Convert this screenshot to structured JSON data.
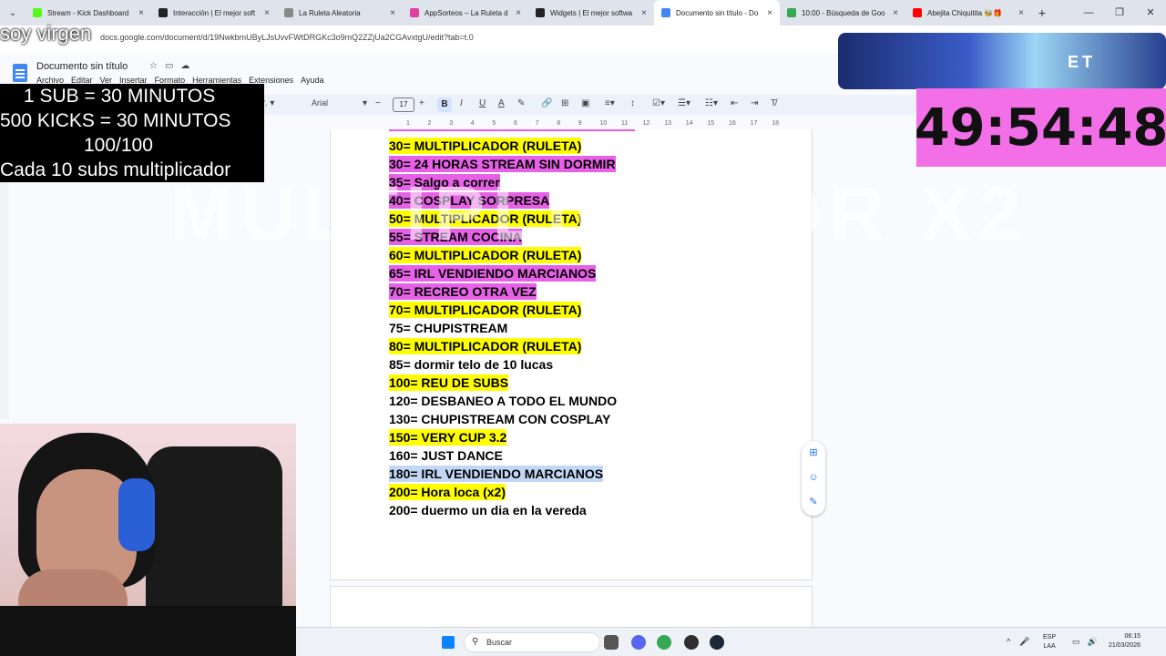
{
  "browser": {
    "tabs": [
      {
        "label": "Stream - Kick Dashboard",
        "color": "#53fc18"
      },
      {
        "label": "Interacción | El mejor soft",
        "color": "#222222"
      },
      {
        "label": "La Ruleta Aleatoria",
        "color": "#888888"
      },
      {
        "label": "AppSorteos – La Ruleta d",
        "color": "#e23fa0"
      },
      {
        "label": "Widgets | El mejor softwa",
        "color": "#222222"
      },
      {
        "label": "Documento sin título - Do",
        "color": "#4285f4",
        "active": true
      },
      {
        "label": "10:00 - Búsqueda de Goo",
        "color": "#34a853"
      },
      {
        "label": "Abejita Chiquitita 🐝🎁",
        "color": "#ff0000"
      }
    ],
    "url": "docs.google.com/document/d/19NwkbmUByLJsUvvFWtDRGKc3o9mQ2ZZjUa2CGAvxtgU/edit?tab=t.0"
  },
  "docs": {
    "title": "Documento sin título",
    "menu": [
      "Archivo",
      "Editar",
      "Ver",
      "Insertar",
      "Formato",
      "Herramientas",
      "Extensiones",
      "Ayuda"
    ],
    "font_name": "Arial",
    "font_size": "17",
    "ruler_numbers": [
      "1",
      "2",
      "3",
      "4",
      "5",
      "6",
      "7",
      "8",
      "9",
      "10",
      "11",
      "12",
      "13",
      "14",
      "15",
      "16",
      "17",
      "18"
    ],
    "lines": [
      {
        "text": "30= MULTIPLICADOR (RULETA)",
        "hl": "y"
      },
      {
        "text": "30= 24 HORAS STREAM SIN DORMIR",
        "hl": "m"
      },
      {
        "text": "35= Salgo a correr",
        "hl": "m"
      },
      {
        "text": "40= COSPLAY SORPRESA",
        "hl": "m"
      },
      {
        "text": "50=  MULTIPLICADOR (RULETA)",
        "hl": "y"
      },
      {
        "text": "55= STREAM COCINA",
        "hl": "m"
      },
      {
        "text": "60=  MULTIPLICADOR (RULETA)",
        "hl": "y"
      },
      {
        "text": "65= IRL VENDIENDO MARCIANOS ",
        "hl": "m"
      },
      {
        "text": "70= RECREO OTRA VEZ",
        "hl": "m"
      },
      {
        "text": "70=  MULTIPLICADOR (RULETA)",
        "hl": "y"
      },
      {
        "text": "75= CHUPISTREAM",
        "hl": ""
      },
      {
        "text": "80=  MULTIPLICADOR (RULETA)",
        "hl": "y"
      },
      {
        "text": "85= dormir telo de 10 lucas",
        "hl": ""
      },
      {
        "text": "100= REU DE SUBS",
        "hl": "y"
      },
      {
        "text": "120= DESBANEO A TODO EL MUNDO",
        "hl": ""
      },
      {
        "text": "130= CHUPISTREAM CON COSPLAY",
        "hl": ""
      },
      {
        "text": "150= VERY CUP 3.2",
        "hl": "y"
      },
      {
        "text": "160= JUST DANCE",
        "hl": ""
      },
      {
        "text": "180= IRL VENDIENDO MARCIANOS",
        "hl": "sel"
      },
      {
        "text": "200= Hora loca (x2)",
        "hl": "y"
      },
      {
        "text": "200= duermo un dia en la vereda",
        "hl": ""
      }
    ]
  },
  "overlay": {
    "watermark": "MULTIPLICADOR X2",
    "soy": "soy virgen",
    "rules": [
      "1 SUB     = 30 MINUTOS",
      "500 KICKS = 30 MINUTOS",
      "100/100",
      "Cada 10 subs multiplicador"
    ],
    "timer": "49:54:48",
    "cam_text": "ET"
  },
  "taskbar": {
    "search_placeholder": "Buscar",
    "lang_top": "ESP",
    "lang_bottom": "LAA",
    "time": "06:15",
    "date": "21/03/2026"
  }
}
